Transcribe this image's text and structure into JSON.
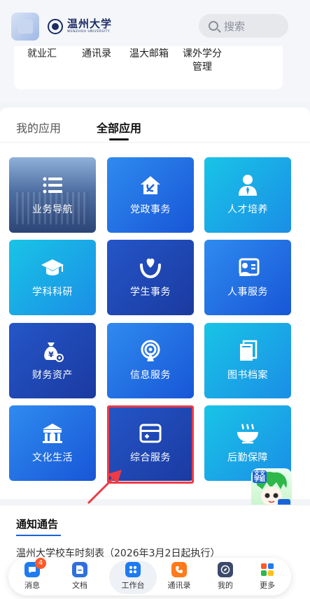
{
  "header": {
    "logo_cn": "温州大学",
    "logo_en": "WENZHOU UNIVERSITY",
    "search_placeholder": "搜索",
    "quicklinks": [
      "就业汇",
      "通讯录",
      "温大邮箱",
      "课外学分\n管理"
    ]
  },
  "tabs": {
    "my_apps": "我的应用",
    "all_apps": "全部应用"
  },
  "tiles": [
    {
      "label": "业务导航",
      "icon": "list-icon"
    },
    {
      "label": "党政事务",
      "icon": "party-emblem-icon"
    },
    {
      "label": "人才培养",
      "icon": "person-tie-icon"
    },
    {
      "label": "学科科研",
      "icon": "graduation-cap-icon"
    },
    {
      "label": "学生事务",
      "icon": "heart-hands-icon"
    },
    {
      "label": "人事服务",
      "icon": "id-card-icon"
    },
    {
      "label": "财务资产",
      "icon": "money-bag-icon"
    },
    {
      "label": "信息服务",
      "icon": "broadcast-icon"
    },
    {
      "label": "图书档案",
      "icon": "books-icon"
    },
    {
      "label": "文化生活",
      "icon": "building-icon"
    },
    {
      "label": "综合服务",
      "icon": "card-box-icon"
    },
    {
      "label": "后勤保障",
      "icon": "bowl-icon"
    }
  ],
  "notice": {
    "title": "通知通告",
    "items": [
      "温州大学校车时刻表（2026年3月2日起执行）"
    ]
  },
  "mascot": {
    "text": "文文学姐"
  },
  "bottom_nav": [
    {
      "label": "消息",
      "icon": "message-icon",
      "badge": "4",
      "color": "#1e7bf0"
    },
    {
      "label": "文档",
      "icon": "document-icon",
      "color": "#2f6fde"
    },
    {
      "label": "工作台",
      "icon": "workbench-icon",
      "color": "#1e7bf0"
    },
    {
      "label": "通讯录",
      "icon": "contacts-icon",
      "color": "#ff7a1a"
    },
    {
      "label": "我的",
      "icon": "compass-icon",
      "color": "#3b4a6b"
    },
    {
      "label": "更多",
      "icon": "more-apps-icon",
      "color": "#ffffff"
    }
  ]
}
